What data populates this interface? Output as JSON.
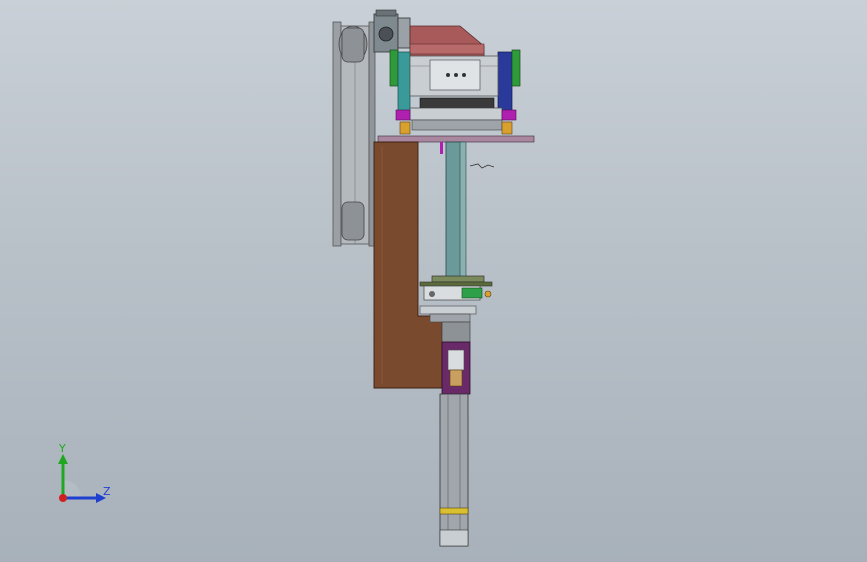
{
  "viewport": {
    "background_top": "#c9d0d7",
    "background_bottom": "#a8b1ba"
  },
  "triad": {
    "y_label": "Y",
    "z_label": "Z",
    "y_color": "#1fa81f",
    "z_color": "#1f3fd0",
    "x_color": "#d01f1f"
  },
  "parts": [
    {
      "name": "left-belt-rail",
      "color": "#9aa0a6"
    },
    {
      "name": "upper-pulley",
      "color": "#8d9296"
    },
    {
      "name": "lower-pulley",
      "color": "#8d9296"
    },
    {
      "name": "top-gearmotor",
      "color": "#7f8a90"
    },
    {
      "name": "motor-cover",
      "color": "#a85a5a"
    },
    {
      "name": "bearing-housing",
      "color": "#c9ced3"
    },
    {
      "name": "left-teal-plate",
      "color": "#3a9a9a"
    },
    {
      "name": "right-blue-plate",
      "color": "#2a3a9a"
    },
    {
      "name": "gear-ring",
      "color": "#3a3a3a"
    },
    {
      "name": "mount-plate",
      "color": "#a9879f"
    },
    {
      "name": "brown-column",
      "color": "#7a4a2e"
    },
    {
      "name": "vertical-shaft",
      "color": "#6a9a9a"
    },
    {
      "name": "clamp-assembly",
      "color": "#7a8a5a"
    },
    {
      "name": "purple-block",
      "color": "#6a2a6a"
    },
    {
      "name": "lower-cylinder",
      "color": "#a0a6ac"
    }
  ]
}
